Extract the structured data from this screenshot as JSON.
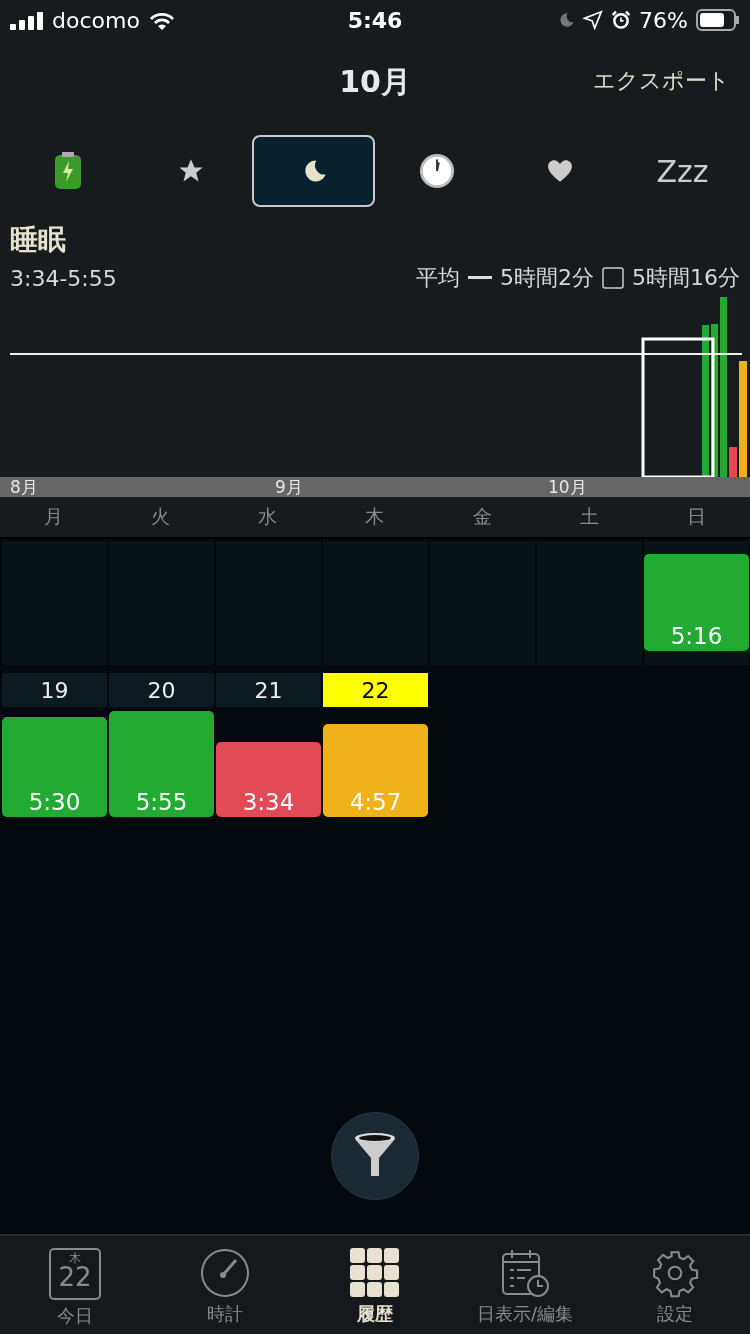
{
  "status_bar": {
    "carrier": "docomo",
    "time": "5:46",
    "battery": "76%"
  },
  "header": {
    "title": "10月",
    "action": "エクスポート"
  },
  "category_tabs": [
    {
      "kind": "battery",
      "selected": false
    },
    {
      "kind": "star",
      "selected": false
    },
    {
      "kind": "moon",
      "selected": true
    },
    {
      "kind": "clock",
      "selected": false
    },
    {
      "kind": "heart",
      "selected": false
    },
    {
      "kind": "text",
      "label": "Zzz",
      "selected": false
    }
  ],
  "section": {
    "title": "睡眠",
    "range": "3:34-5:55",
    "average_label": "平均",
    "average_value": "5時間2分",
    "total_value": "5時間16分"
  },
  "timeline": {
    "months": [
      "8月",
      "9月",
      "10月"
    ]
  },
  "weekdays": [
    "月",
    "火",
    "水",
    "木",
    "金",
    "土",
    "日"
  ],
  "weeks": [
    {
      "cells": [
        {
          "kind": "empty"
        },
        {
          "kind": "empty"
        },
        {
          "kind": "empty"
        },
        {
          "kind": "empty"
        },
        {
          "kind": "empty"
        },
        {
          "kind": "empty"
        },
        {
          "kind": "entry",
          "duration": "5:16",
          "color": "#22aa33"
        }
      ]
    },
    {
      "cells": [
        {
          "kind": "entry",
          "day": "19",
          "today": false,
          "duration": "5:30",
          "color": "#22aa33"
        },
        {
          "kind": "entry",
          "day": "20",
          "today": false,
          "duration": "5:55",
          "color": "#22aa33"
        },
        {
          "kind": "entry",
          "day": "21",
          "today": false,
          "duration": "3:34",
          "color": "#e24a55"
        },
        {
          "kind": "entry",
          "day": "22",
          "today": true,
          "duration": "4:57",
          "color": "#efb21a"
        }
      ]
    }
  ],
  "tab_bar": [
    {
      "kind": "calendar",
      "label": "今日",
      "weekday": "木",
      "day": "22",
      "selected": false
    },
    {
      "kind": "clock",
      "label": "時計",
      "selected": false
    },
    {
      "kind": "grid",
      "label": "履歴",
      "selected": true
    },
    {
      "kind": "schedule",
      "label": "日表示/編集",
      "selected": false
    },
    {
      "kind": "gear",
      "label": "設定",
      "selected": false
    }
  ]
}
